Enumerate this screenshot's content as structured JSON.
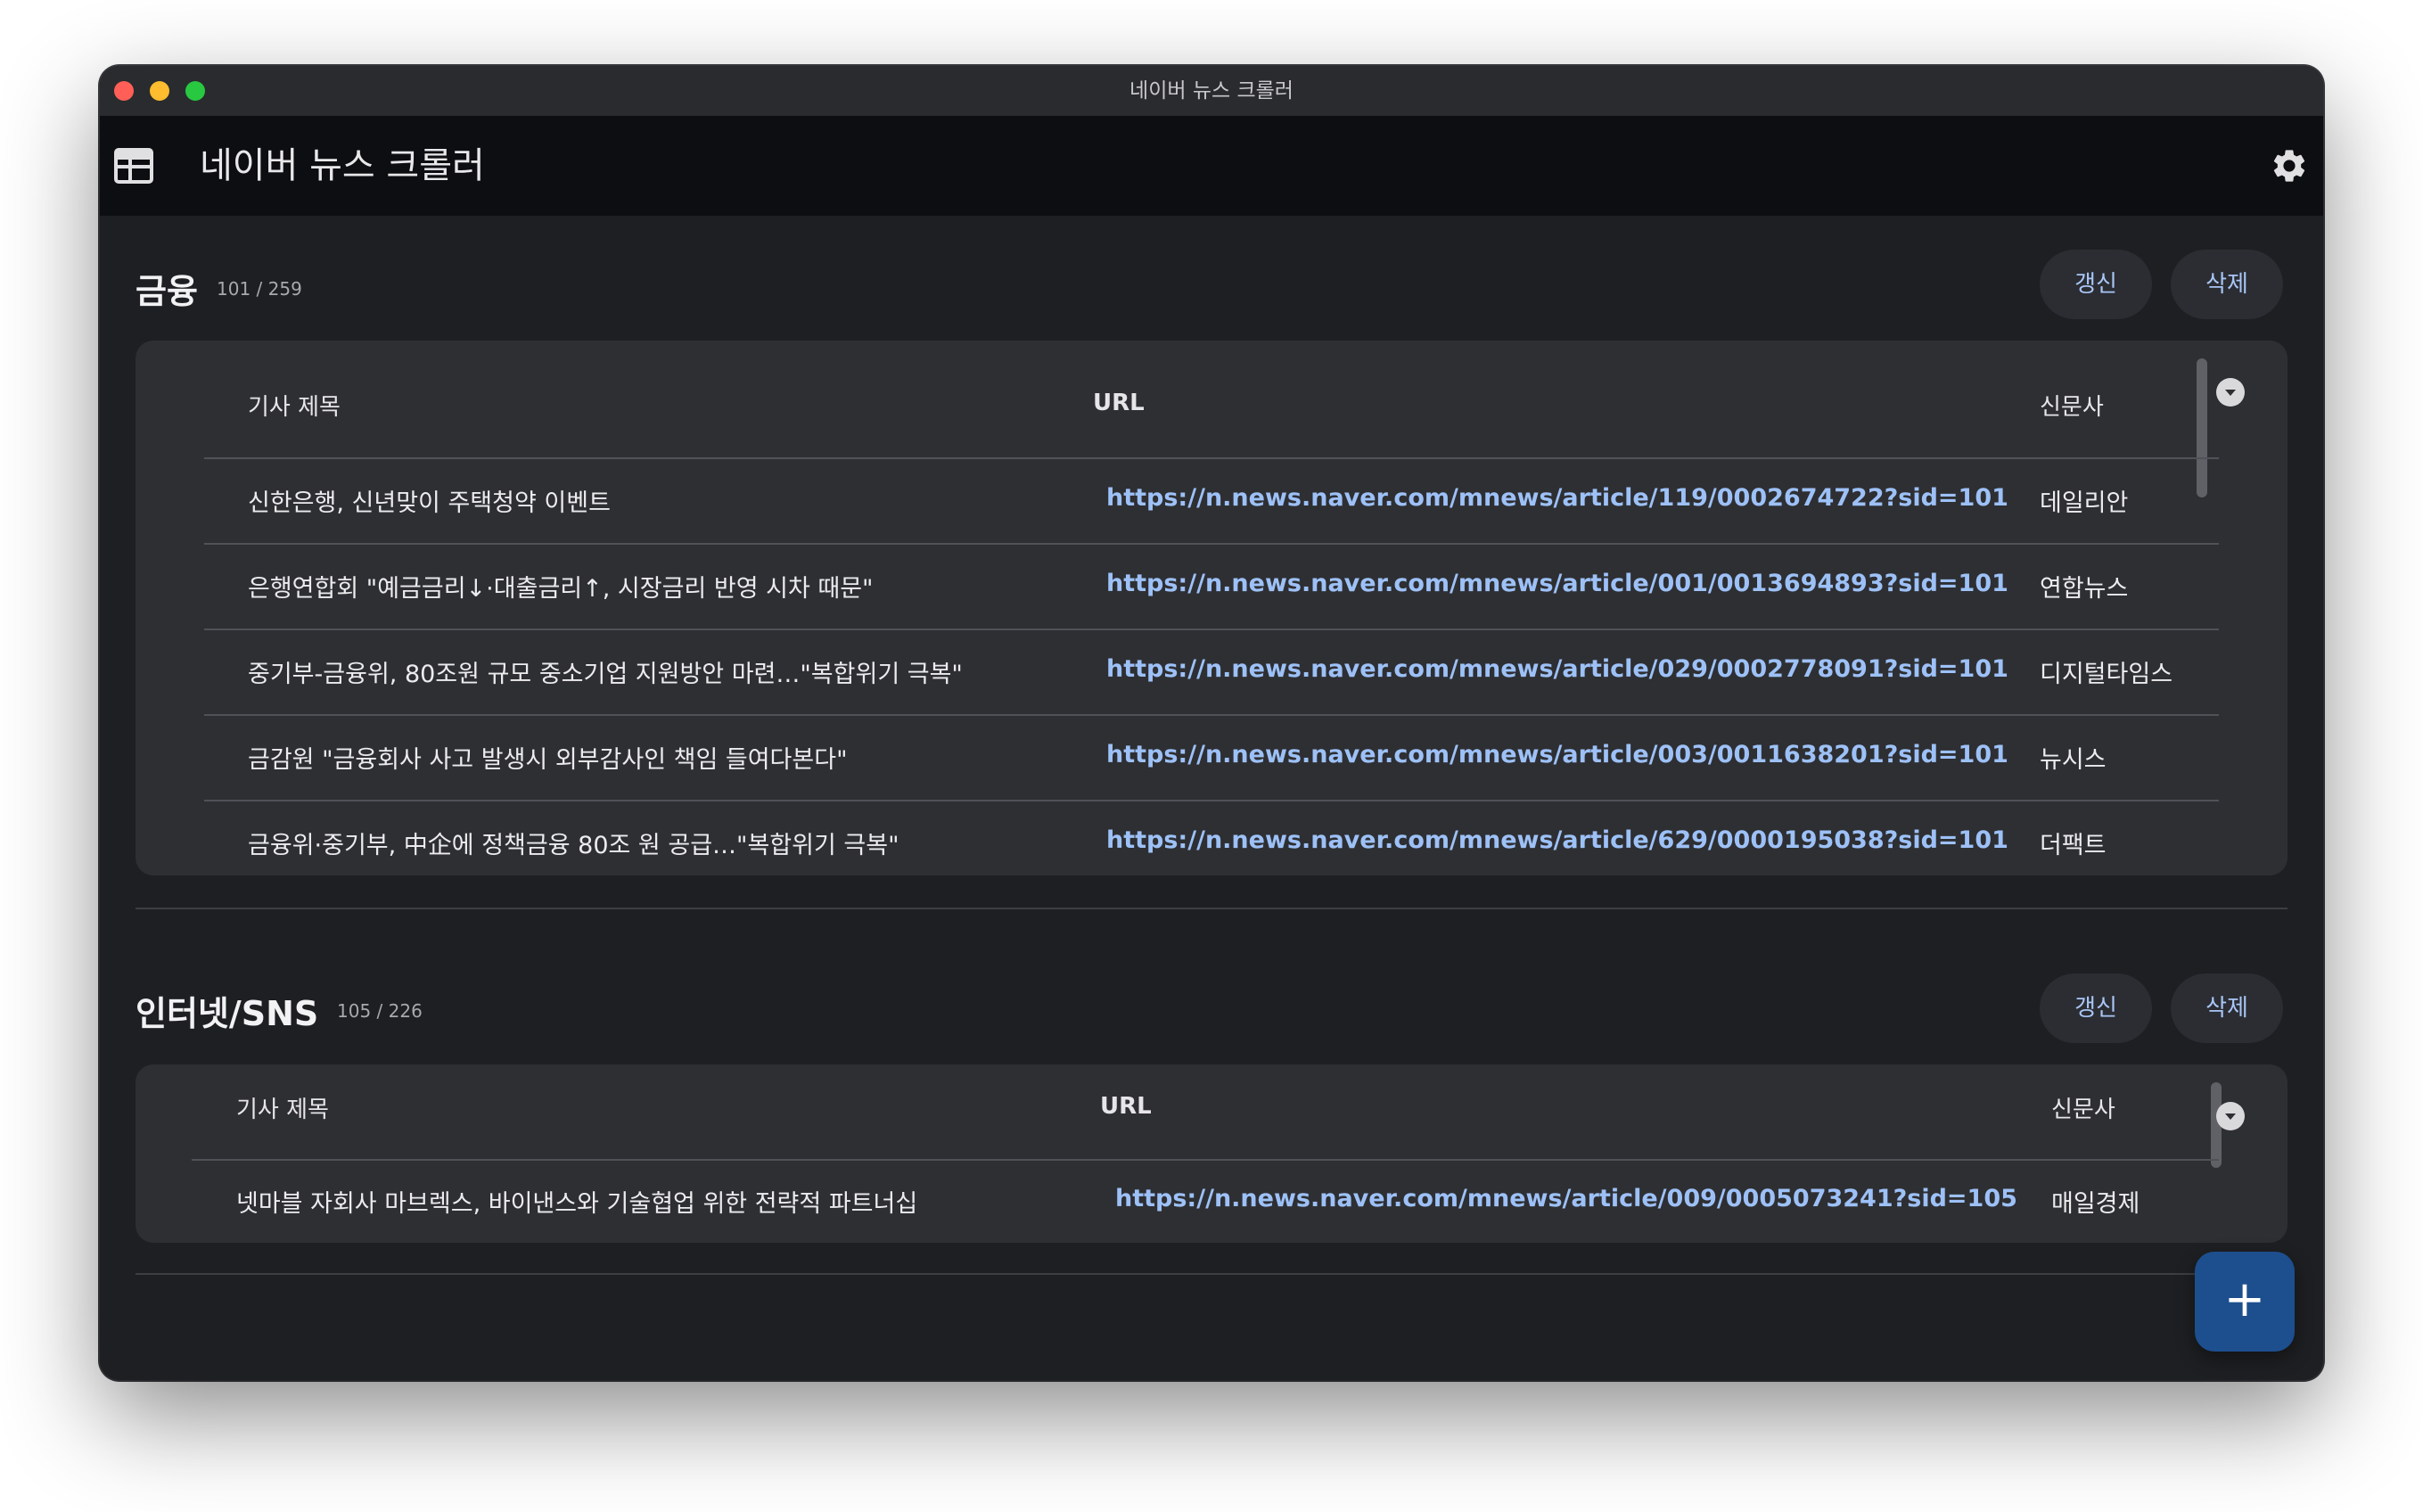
{
  "window": {
    "title": "네이버 뉴스 크롤러"
  },
  "appbar": {
    "title": "네이버 뉴스 크롤러",
    "left_icon": "table-icon",
    "right_icon": "gear-icon"
  },
  "columns": {
    "title": "기사 제목",
    "url": "URL",
    "press": "신문사"
  },
  "sections": [
    {
      "title": "금융",
      "count": "101 / 259",
      "refresh_label": "갱신",
      "delete_label": "삭제",
      "rows": [
        {
          "title": "신한은행, 신년맞이 주택청약 이벤트",
          "url": "https://n.news.naver.com/mnews/article/119/0002674722?sid=101",
          "press": "데일리안"
        },
        {
          "title": "은행연합회 \"예금금리↓·대출금리↑, 시장금리 반영 시차 때문\"",
          "url": "https://n.news.naver.com/mnews/article/001/0013694893?sid=101",
          "press": "연합뉴스"
        },
        {
          "title": "중기부-금융위, 80조원 규모 중소기업 지원방안 마련…\"복합위기 극복\"",
          "url": "https://n.news.naver.com/mnews/article/029/0002778091?sid=101",
          "press": "디지털타임스"
        },
        {
          "title": "금감원 \"금융회사 사고 발생시 외부감사인 책임 들여다본다\"",
          "url": "https://n.news.naver.com/mnews/article/003/0011638201?sid=101",
          "press": "뉴시스"
        },
        {
          "title": "금융위·중기부, 中企에 정책금융 80조 원 공급…\"복합위기 극복\"",
          "url": "https://n.news.naver.com/mnews/article/629/0000195038?sid=101",
          "press": "더팩트"
        }
      ]
    },
    {
      "title": "인터넷/SNS",
      "count": "105 / 226",
      "refresh_label": "갱신",
      "delete_label": "삭제",
      "rows": [
        {
          "title": "넷마블 자회사 마브렉스, 바이낸스와 기술협업 위한 전략적 파트너십",
          "url": "https://n.news.naver.com/mnews/article/009/0005073241?sid=105",
          "press": "매일경제"
        }
      ]
    }
  ],
  "fab": {
    "label": "+"
  }
}
